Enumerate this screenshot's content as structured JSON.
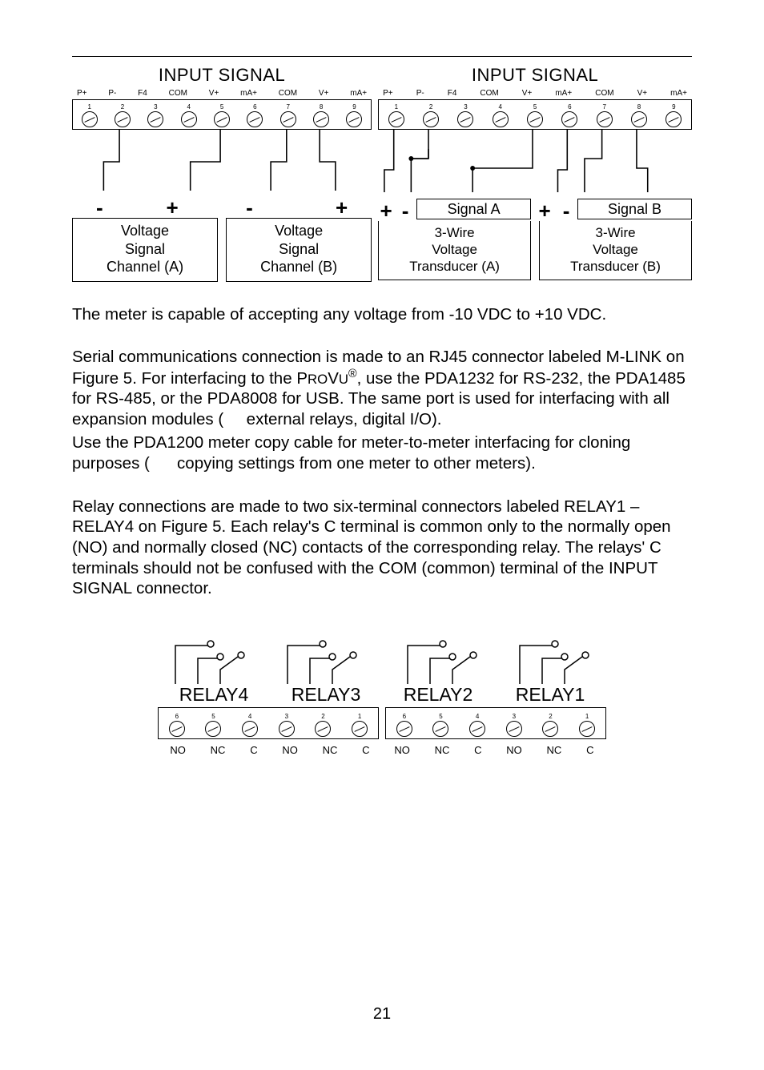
{
  "page_number": "21",
  "fig_top": {
    "left": {
      "title": "INPUT SIGNAL",
      "caps": [
        "P+",
        "P-",
        "F4",
        "COM",
        "V+",
        "mA+",
        "COM",
        "V+",
        "mA+"
      ],
      "nums": [
        "1",
        "2",
        "3",
        "4",
        "5",
        "6",
        "7",
        "8",
        "9"
      ],
      "signs": [
        "-",
        "+",
        "-",
        "+"
      ],
      "box_a": "Voltage\nSignal\nChannel (A)",
      "box_b": "Voltage\nSignal\nChannel (B)"
    },
    "right": {
      "title": "INPUT SIGNAL",
      "caps": [
        "P+",
        "P-",
        "F4",
        "COM",
        "V+",
        "mA+",
        "COM",
        "V+",
        "mA+"
      ],
      "nums": [
        "1",
        "2",
        "3",
        "4",
        "5",
        "6",
        "7",
        "8",
        "9"
      ],
      "s1": "+",
      "s2": "-",
      "siga": "Signal A",
      "s3": "+",
      "s4": "-",
      "sigb": "Signal B",
      "box_a": "3-Wire\nVoltage\nTransducer (A)",
      "box_b": "3-Wire\nVoltage\nTransducer (B)"
    }
  },
  "paragraphs": {
    "p1": "The meter is capable of accepting any voltage from -10 VDC to +10 VDC.",
    "p2a": "Serial communications connection is made to an RJ45 connector labeled M-LINK on Figure 5. For interfacing to the ",
    "p2_brand1": "P",
    "p2_brand2": "RO",
    "p2_brand3": "V",
    "p2_brand4": "U",
    "p2_reg": "®",
    "p2b": ", use the PDA1232 for RS-232, the PDA1485 for RS-485, or the PDA8008 for USB. The same port is used for interfacing with all expansion modules (",
    "p2c": " external relays, digital I/O).",
    "p3a": "Use the PDA1200 meter copy cable for meter-to-meter interfacing for cloning purposes (",
    "p3b": " copying settings from one meter to other meters).",
    "p4": "Relay connections are made to two six-terminal connectors labeled RELAY1 – RELAY4 on Figure 5. Each relay's C terminal is common only to the normally open (NO) and normally closed (NC) contacts of the corresponding relay. The relays' C terminals should not be confused with the COM (common) terminal of the INPUT SIGNAL connector."
  },
  "relay": {
    "labels": [
      "RELAY4",
      "RELAY3",
      "RELAY2",
      "RELAY1"
    ],
    "nums_left": [
      "6",
      "5",
      "4",
      "3",
      "2",
      "1"
    ],
    "nums_right": [
      "6",
      "5",
      "4",
      "3",
      "2",
      "1"
    ],
    "caps": [
      "NO",
      "NC",
      "C",
      "NO",
      "NC",
      "C",
      "NO",
      "NC",
      "C",
      "NO",
      "NC",
      "C"
    ]
  }
}
